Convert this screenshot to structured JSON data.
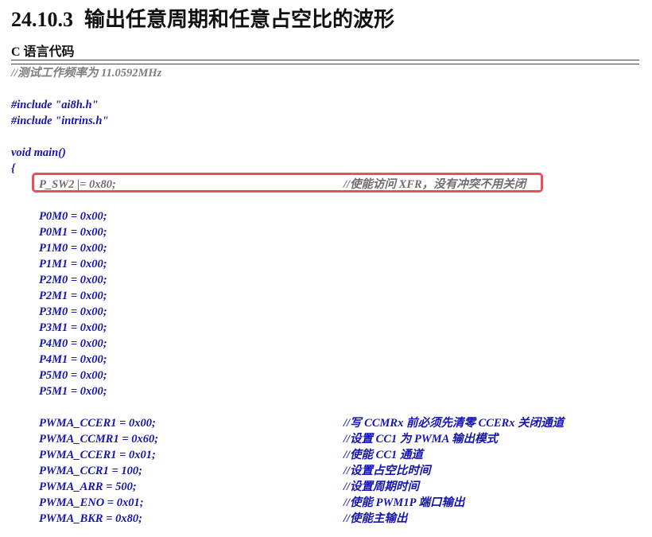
{
  "heading": {
    "number": "24.10.3",
    "title": "输出任意周期和任意占空比的波形"
  },
  "sublabel": "C 语言代码",
  "code": {
    "header_comment": "//测试工作频率为 11.0592MHz",
    "include1": "#include \"ai8h.h\"",
    "include2": "#include \"intrins.h\"",
    "main_decl": "void main()",
    "open_brace": "{",
    "psw2": {
      "code": "P_SW2 |= 0x80;",
      "comment": "//使能访问 XFR，没有冲突不用关闭"
    },
    "port_lines": [
      "P0M0 = 0x00;",
      "P0M1 = 0x00;",
      "P1M0 = 0x00;",
      "P1M1 = 0x00;",
      "P2M0 = 0x00;",
      "P2M1 = 0x00;",
      "P3M0 = 0x00;",
      "P3M1 = 0x00;",
      "P4M0 = 0x00;",
      "P4M1 = 0x00;",
      "P5M0 = 0x00;",
      "P5M1 = 0x00;"
    ],
    "pwm_lines": [
      {
        "code": "PWMA_CCER1 = 0x00;",
        "comment": "//写 CCMRx 前必须先清零 CCERx 关闭通道"
      },
      {
        "code": "PWMA_CCMR1 = 0x60;",
        "comment": "//设置 CC1 为 PWMA 输出模式"
      },
      {
        "code": "PWMA_CCER1 = 0x01;",
        "comment": "//使能 CC1 通道"
      },
      {
        "code": "PWMA_CCR1 = 100;",
        "comment": "//设置占空比时间"
      },
      {
        "code": "PWMA_ARR = 500;",
        "comment": "//设置周期时间"
      },
      {
        "code": "PWMA_ENO = 0x01;",
        "comment": "//使能 PWM1P 端口输出"
      },
      {
        "code": "PWMA_BKR = 0x80;",
        "comment": "//使能主输出"
      }
    ]
  },
  "colors": {
    "code": "#1414b4",
    "highlight_border": "#e8505f",
    "heading": "#111111"
  }
}
